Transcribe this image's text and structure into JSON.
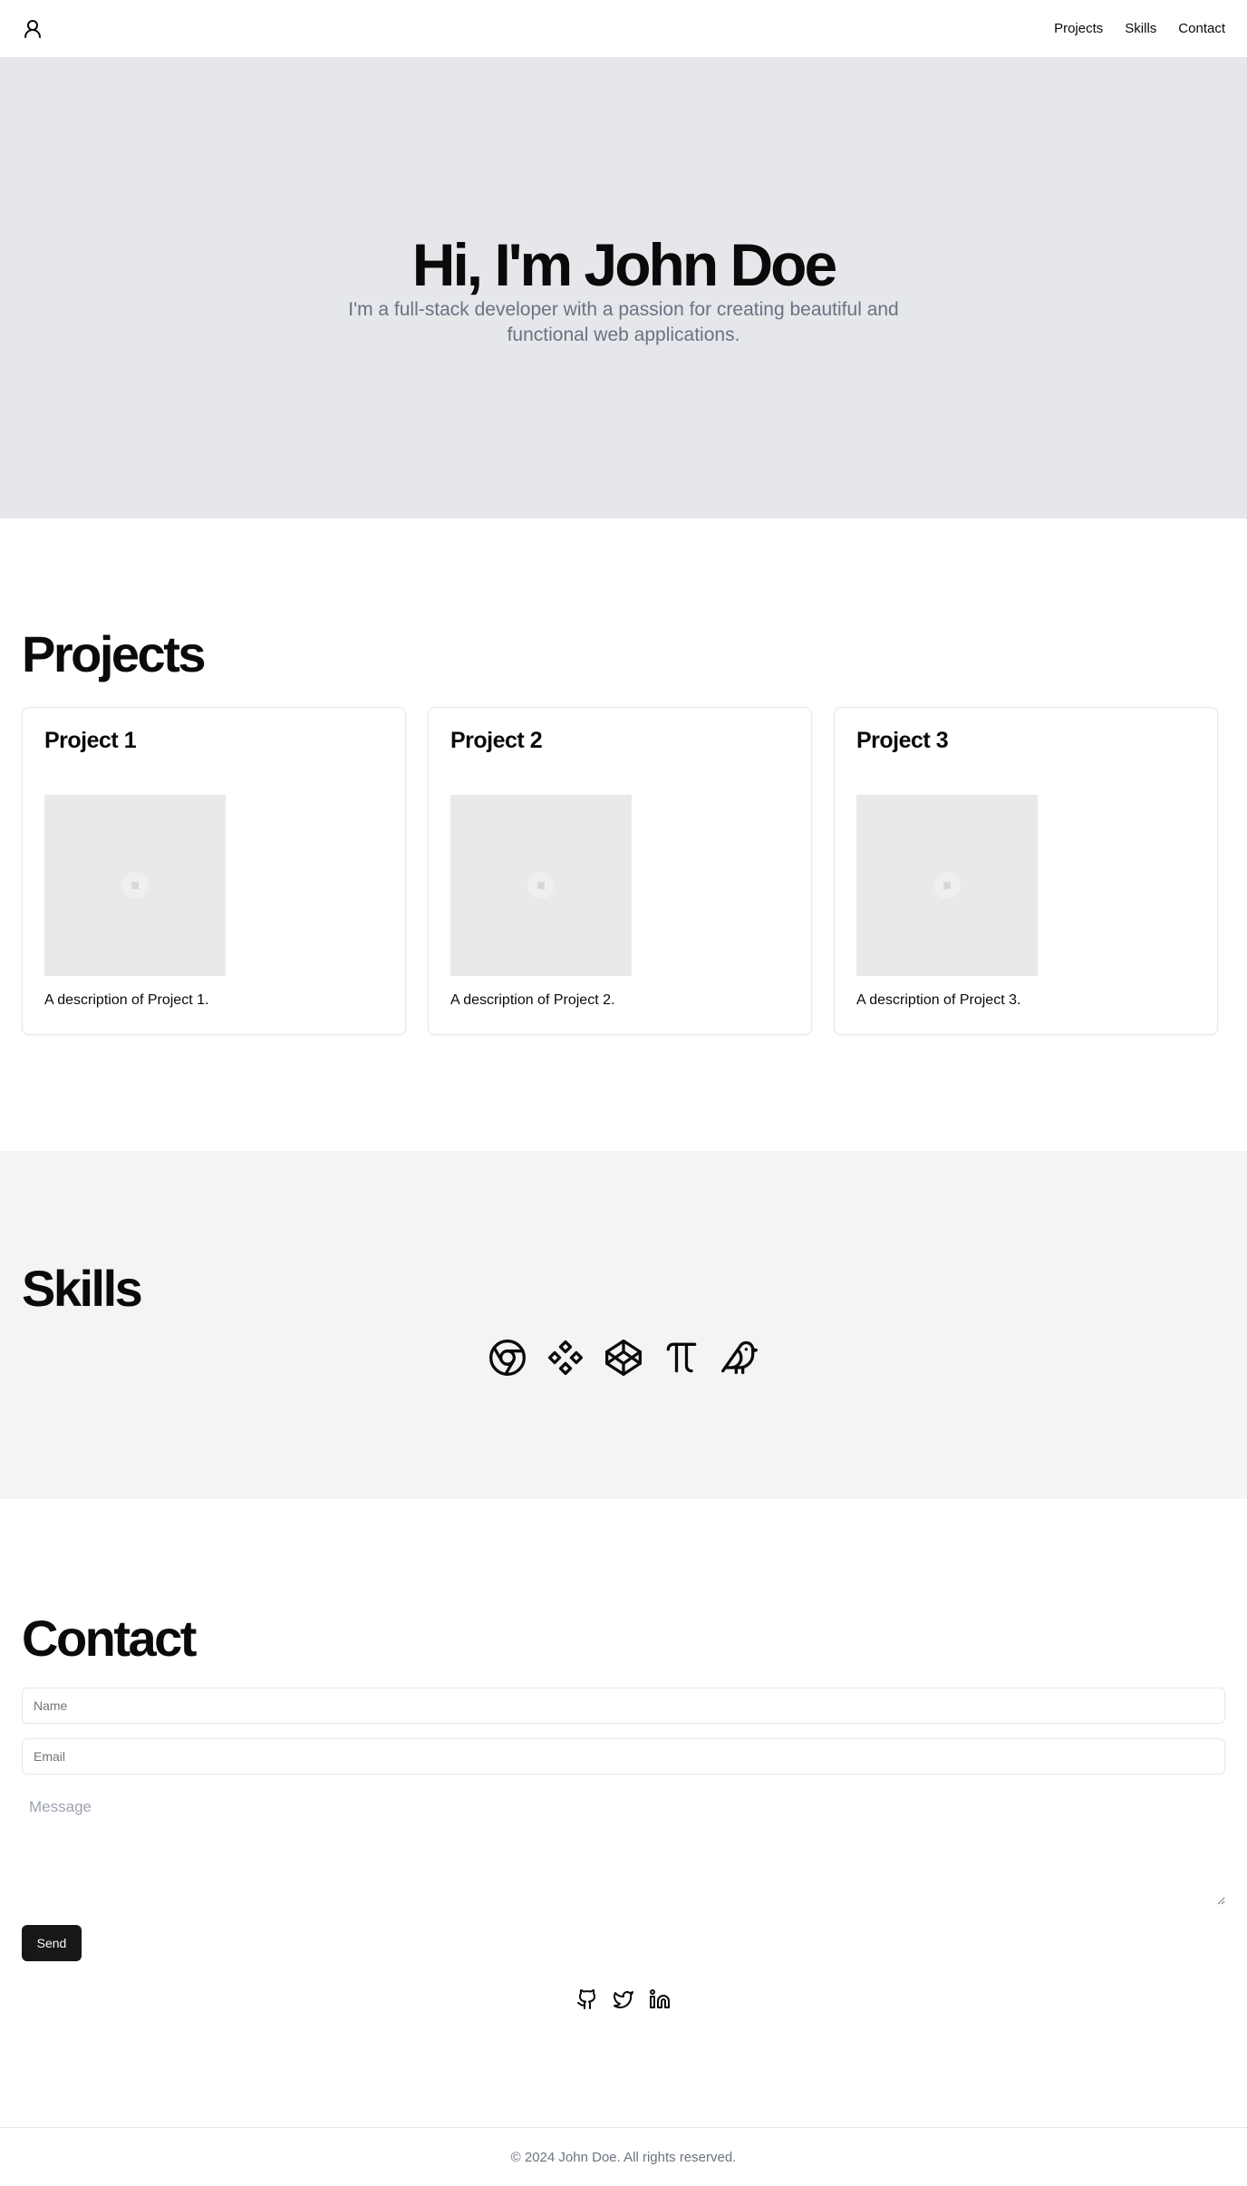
{
  "header": {
    "logo_icon": "user-icon",
    "nav": [
      {
        "label": "Projects"
      },
      {
        "label": "Skills"
      },
      {
        "label": "Contact"
      }
    ]
  },
  "hero": {
    "title": "Hi, I'm John Doe",
    "subtitle": "I'm a full-stack developer with a passion for creating beautiful and functional web applications."
  },
  "projects": {
    "title": "Projects",
    "items": [
      {
        "name": "Project 1",
        "description": "A description of Project 1.",
        "image_icon": "image-placeholder-icon"
      },
      {
        "name": "Project 2",
        "description": "A description of Project 2.",
        "image_icon": "image-placeholder-icon"
      },
      {
        "name": "Project 3",
        "description": "A description of Project 3.",
        "image_icon": "image-placeholder-icon"
      }
    ]
  },
  "skills": {
    "title": "Skills",
    "icons": [
      "chrome-icon",
      "figma-icon",
      "codepen-icon",
      "pi-icon",
      "bird-icon"
    ]
  },
  "contact": {
    "title": "Contact",
    "name_placeholder": "Name",
    "email_placeholder": "Email",
    "message_placeholder": "Message",
    "send_label": "Send",
    "social_icons": [
      "github-icon",
      "twitter-icon",
      "linkedin-icon"
    ]
  },
  "footer": {
    "text": "© 2024 John Doe. All rights reserved."
  },
  "colors": {
    "hero_bg": "#e5e7eb",
    "skills_bg": "#f3f4f6",
    "button_bg": "#171717",
    "muted_text": "#6b7280"
  }
}
